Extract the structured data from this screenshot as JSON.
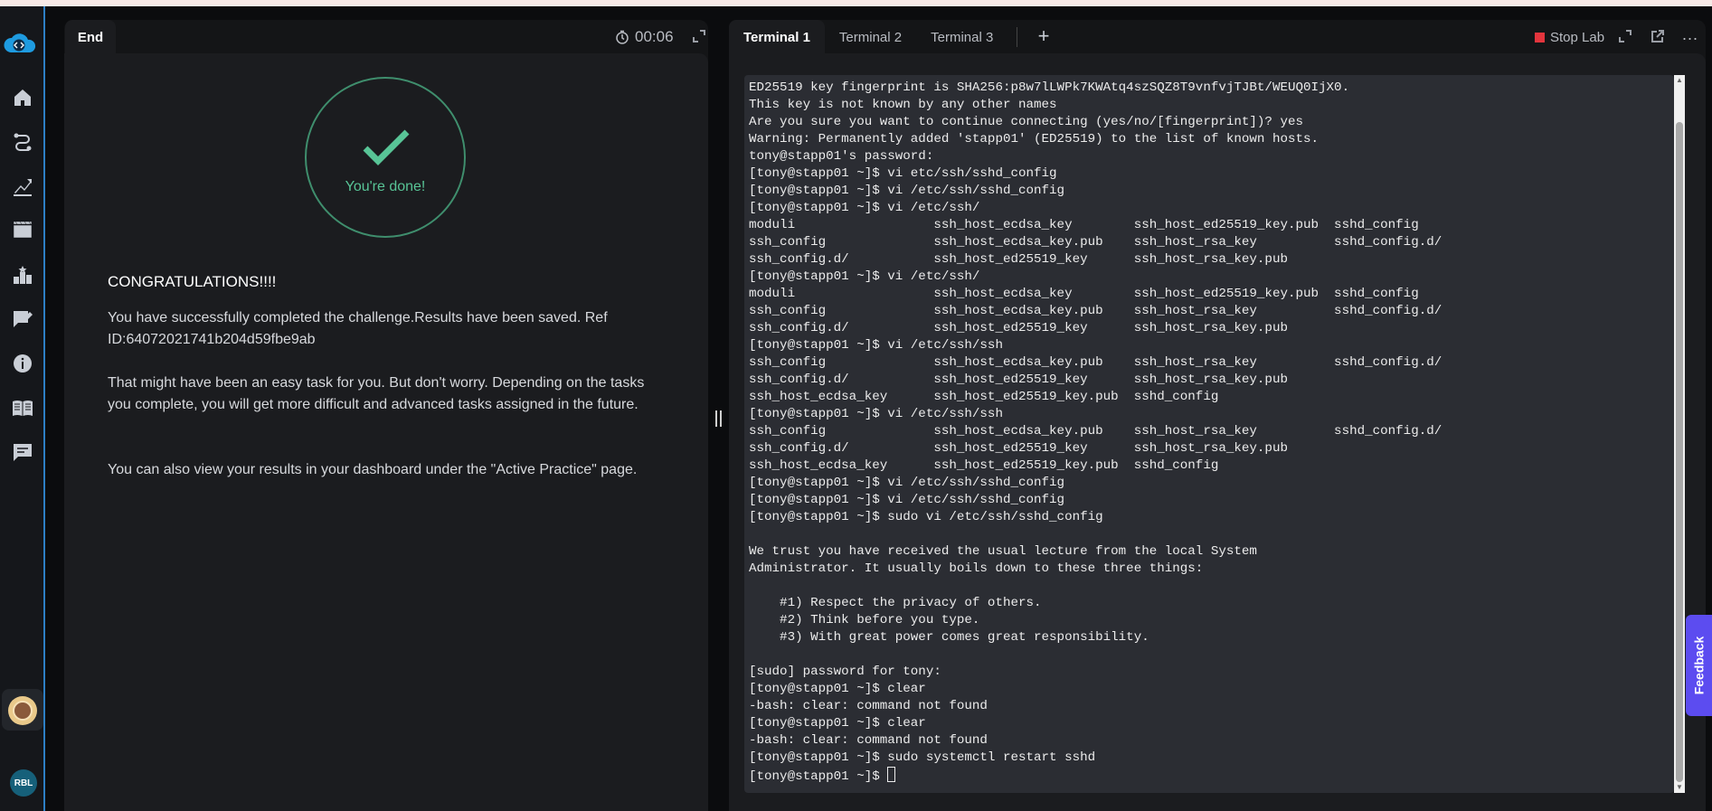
{
  "left_panel": {
    "tab_label": "End",
    "timer": "00:06",
    "done_text": "You're done!",
    "congrats": "CONGRATULATIONS!!!!",
    "message1": "You have successfully completed the challenge.Results have been saved. Ref ID:64072021741b204d59fbe9ab",
    "message2": "That might have been an easy task for you. But don't worry. Depending on the tasks you complete, you will get more difficult and advanced tasks assigned in the future.",
    "message3": "You can also view your results in your dashboard under the \"Active Practice\" page."
  },
  "right_panel": {
    "tabs": [
      "Terminal 1",
      "Terminal 2",
      "Terminal 3"
    ],
    "active_tab": "Terminal 1",
    "add_tab": "+",
    "stop_lab": "Stop Lab",
    "more": "...",
    "terminal_lines": [
      "ED25519 key fingerprint is SHA256:p8w7lLWPk7KWAtq4szSQZ8T9vnfvjTJBt/WEUQ0IjX0.",
      "This key is not known by any other names",
      "Are you sure you want to continue connecting (yes/no/[fingerprint])? yes",
      "Warning: Permanently added 'stapp01' (ED25519) to the list of known hosts.",
      "tony@stapp01's password:",
      "[tony@stapp01 ~]$ vi etc/ssh/sshd_config",
      "[tony@stapp01 ~]$ vi /etc/ssh/sshd_config",
      "[tony@stapp01 ~]$ vi /etc/ssh/",
      "moduli                  ssh_host_ecdsa_key        ssh_host_ed25519_key.pub  sshd_config",
      "ssh_config              ssh_host_ecdsa_key.pub    ssh_host_rsa_key          sshd_config.d/",
      "ssh_config.d/           ssh_host_ed25519_key      ssh_host_rsa_key.pub",
      "[tony@stapp01 ~]$ vi /etc/ssh/",
      "moduli                  ssh_host_ecdsa_key        ssh_host_ed25519_key.pub  sshd_config",
      "ssh_config              ssh_host_ecdsa_key.pub    ssh_host_rsa_key          sshd_config.d/",
      "ssh_config.d/           ssh_host_ed25519_key      ssh_host_rsa_key.pub",
      "[tony@stapp01 ~]$ vi /etc/ssh/ssh",
      "ssh_config              ssh_host_ecdsa_key.pub    ssh_host_rsa_key          sshd_config.d/",
      "ssh_config.d/           ssh_host_ed25519_key      ssh_host_rsa_key.pub",
      "ssh_host_ecdsa_key      ssh_host_ed25519_key.pub  sshd_config",
      "[tony@stapp01 ~]$ vi /etc/ssh/ssh",
      "ssh_config              ssh_host_ecdsa_key.pub    ssh_host_rsa_key          sshd_config.d/",
      "ssh_config.d/           ssh_host_ed25519_key      ssh_host_rsa_key.pub",
      "ssh_host_ecdsa_key      ssh_host_ed25519_key.pub  sshd_config",
      "[tony@stapp01 ~]$ vi /etc/ssh/sshd_config",
      "[tony@stapp01 ~]$ vi /etc/ssh/sshd_config",
      "[tony@stapp01 ~]$ sudo vi /etc/ssh/sshd_config",
      "",
      "We trust you have received the usual lecture from the local System",
      "Administrator. It usually boils down to these three things:",
      "",
      "    #1) Respect the privacy of others.",
      "    #2) Think before you type.",
      "    #3) With great power comes great responsibility.",
      "",
      "[sudo] password for tony:",
      "[tony@stapp01 ~]$ clear",
      "-bash: clear: command not found",
      "[tony@stapp01 ~]$ clear",
      "-bash: clear: command not found",
      "[tony@stapp01 ~]$ sudo systemctl restart sshd"
    ],
    "prompt": "[tony@stapp01 ~]$ "
  },
  "sidebar": {
    "icons": [
      "home-icon",
      "roadmap-icon",
      "progress-icon",
      "video-icon",
      "leaderboard-icon",
      "feedback-notes-icon",
      "info-icon",
      "book-icon",
      "chat-icon"
    ],
    "user_initials": "RBL"
  },
  "feedback_tab": "Feedback",
  "colors": {
    "accent": "#2d7fc4",
    "success": "#58c496",
    "stop": "#e3353d",
    "feedback": "#5c4cf0"
  }
}
